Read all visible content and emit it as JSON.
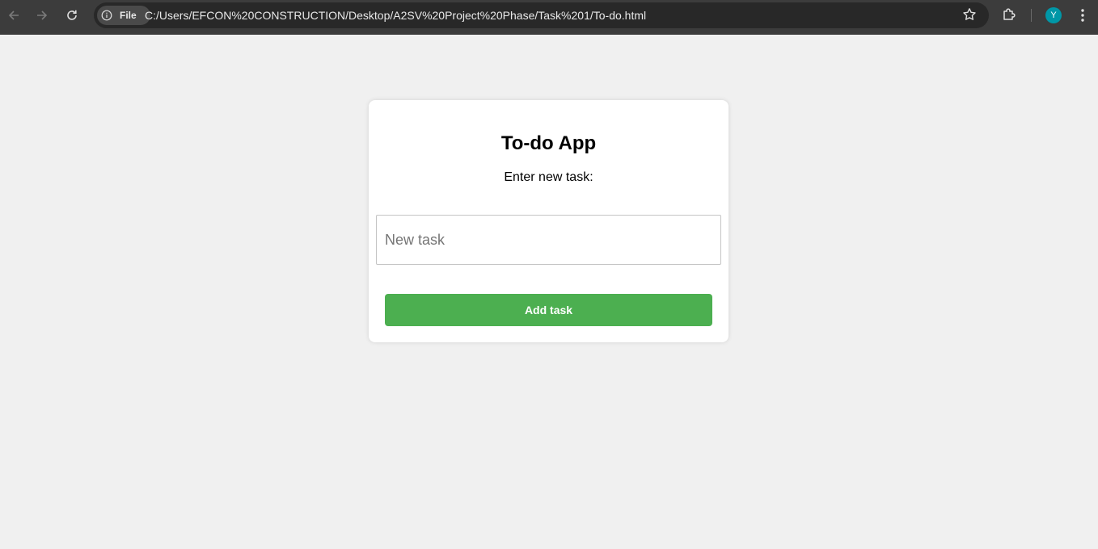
{
  "browser": {
    "chip_label": "File",
    "url": "C:/Users/EFCON%20CONSTRUCTION/Desktop/A2SV%20Project%20Phase/Task%201/To-do.html",
    "profile_initial": "Y",
    "icons": {
      "back": "arrow-left-icon",
      "forward": "arrow-right-icon",
      "reload": "reload-icon",
      "info": "info-icon",
      "bookmark": "star-icon",
      "extensions": "puzzle-icon",
      "menu": "kebab-menu-icon"
    },
    "colors": {
      "toolbar": "#3c3c3c",
      "omnibox": "#282828",
      "avatar": "#0097a7"
    }
  },
  "app": {
    "title": "To-do App",
    "prompt": "Enter new task:",
    "input": {
      "value": "",
      "placeholder": "New task"
    },
    "add_button_label": "Add task",
    "colors": {
      "background": "#f0f0f0",
      "card": "#ffffff",
      "button": "#4caf50"
    }
  }
}
